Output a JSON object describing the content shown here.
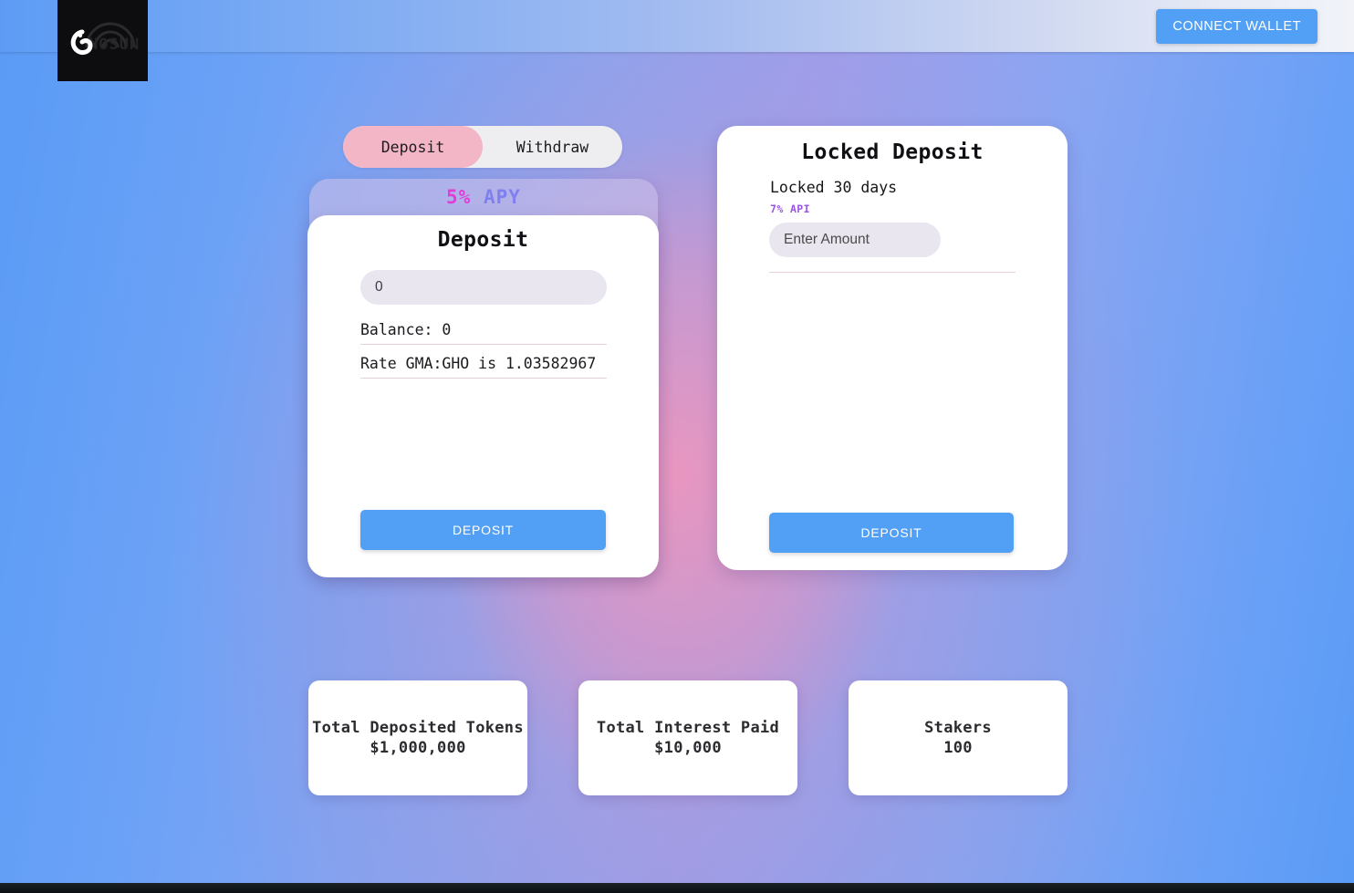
{
  "header": {
    "logo_alt": "gnosun-logo",
    "connect_wallet_label": "CONNECT WALLET"
  },
  "toggle": {
    "deposit_label": "Deposit",
    "withdraw_label": "Withdraw",
    "active": "Deposit"
  },
  "deposit_panel": {
    "apy_number": "5%",
    "apy_label": "APY",
    "title": "Deposit",
    "amount_value": "0",
    "amount_placeholder": "0",
    "balance_row": "Balance: 0",
    "rate_row": "Rate GMA:GHO is 1.03582967",
    "submit_label": "DEPOSIT"
  },
  "locked_panel": {
    "title": "Locked Deposit",
    "locked_period": "Locked 30 days",
    "api_label": "7% API",
    "amount_value": "",
    "amount_placeholder": "Enter Amount",
    "submit_label": "DEPOSIT"
  },
  "stats": [
    {
      "label": "Total Deposited Tokens",
      "value": "$1,000,000"
    },
    {
      "label": "Total Interest Paid",
      "value": "$10,000"
    },
    {
      "label": "Stakers",
      "value": "100"
    }
  ],
  "colors": {
    "accent_blue": "#52a0f5",
    "toggle_active_pink": "#f2b6c6",
    "apy_magenta": "#e03ed6",
    "apy_purple": "#7f7ff0",
    "api_purple": "#9b55e8",
    "card_white": "#ffffff",
    "input_grey": "#e9e6ef",
    "divider_pink": "#e6cdd6"
  }
}
